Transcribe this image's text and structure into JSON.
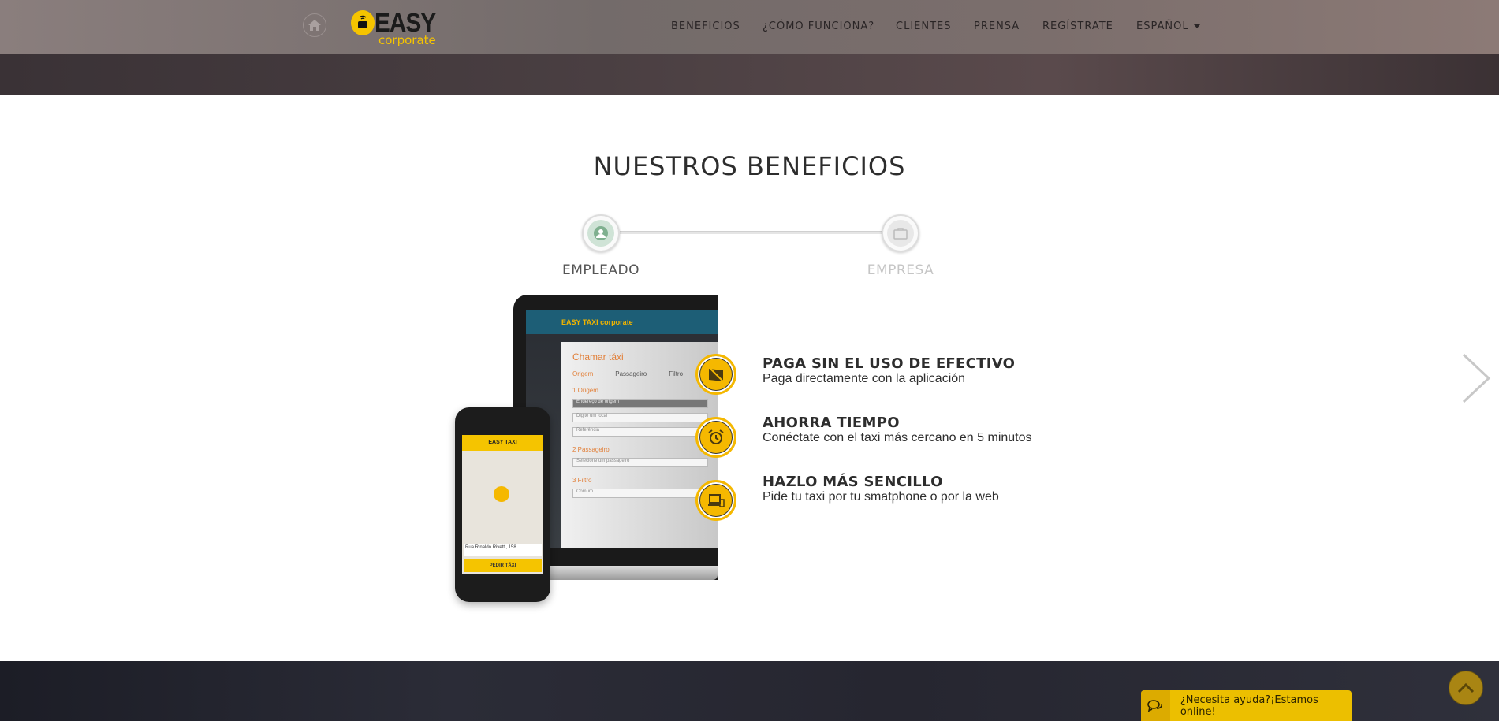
{
  "header": {
    "logo_main": "EASY",
    "logo_sub": "corporate",
    "nav": [
      "BENEFICIOS",
      "¿CÓMO FUNCIONA?",
      "CLIENTES",
      "PRENSA",
      "REGÍSTRATE"
    ],
    "language": "ESPAÑOL"
  },
  "section": {
    "title": "NUESTROS BENEFICIOS",
    "tabs": [
      {
        "label": "EMPLEADO",
        "active": true
      },
      {
        "label": "EMPRESA",
        "active": false
      }
    ]
  },
  "mockup": {
    "laptop_brand": "EASY TAXI corporate",
    "panel_title": "Chamar táxi",
    "panel_tabs": [
      "Origem",
      "Passageiro",
      "Filtro"
    ],
    "fields": [
      "Endereço de origem",
      "Digite um local",
      "Referência"
    ],
    "sections": [
      "1 Origem",
      "2 Passageiro",
      "3 Filtro"
    ],
    "passenger_select": "Selecione um passageiro",
    "filter_select": "Comum",
    "phone_brand": "EASY TAXI",
    "phone_address": "Rua Rinaldo Rivetti, 158",
    "phone_button": "PEDIR TÁXI"
  },
  "features": [
    {
      "title": "PAGA SIN EL USO DE EFECTIVO",
      "desc": "Paga directamente con la aplicación",
      "icon": "no-cash-icon"
    },
    {
      "title": "AHORRA TIEMPO",
      "desc": "Conéctate con el taxi más cercano en 5 minutos",
      "icon": "alarm-clock-icon"
    },
    {
      "title": "HAZLO MÁS SENCILLO",
      "desc": "Pide tu taxi por tu smatphone o por la web",
      "icon": "devices-icon"
    }
  ],
  "chat": {
    "label": "¿Necesita ayuda?¡Estamos online!"
  },
  "colors": {
    "accent": "#f5b800",
    "chat": "#ecbf00"
  }
}
